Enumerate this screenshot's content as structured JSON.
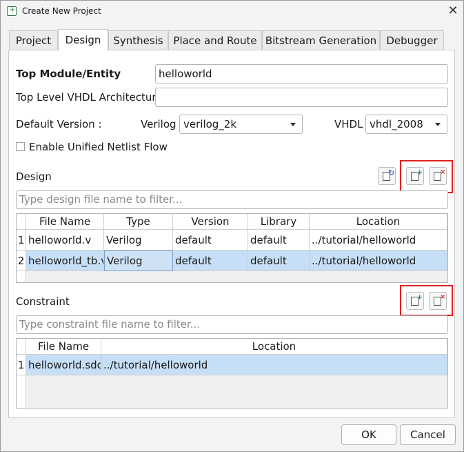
{
  "window": {
    "title": "Create New Project",
    "close_glyph": "✕"
  },
  "tabs": [
    "Project",
    "Design",
    "Synthesis",
    "Place and Route",
    "Bitstream Generation",
    "Debugger"
  ],
  "active_tab": "Design",
  "top_module": {
    "label": "Top Module/Entity",
    "value": "helloworld"
  },
  "top_vhdl_arch": {
    "label": "Top Level VHDL Architecture",
    "value": ""
  },
  "default_version": {
    "label": "Default Version :",
    "verilog_label": "Verilog",
    "verilog_value": "verilog_2k",
    "vhdl_label": "VHDL",
    "vhdl_value": "vhdl_2008"
  },
  "unified_netlist": {
    "label": "Enable Unified Netlist Flow",
    "checked": false
  },
  "design": {
    "label": "Design",
    "filter_placeholder": "Type design file name to filter...",
    "columns": [
      "File Name",
      "Type",
      "Version",
      "Library",
      "Location"
    ],
    "rows": [
      {
        "num": "1",
        "file": "helloworld.v",
        "type": "Verilog",
        "version": "default",
        "library": "default",
        "location": "../tutorial/helloworld"
      },
      {
        "num": "2",
        "file": "helloworld_tb.v",
        "type": "Verilog",
        "version": "default",
        "library": "default",
        "location": "../tutorial/helloworld"
      }
    ],
    "selected_row": 2
  },
  "constraint": {
    "label": "Constraint",
    "filter_placeholder": "Type constraint file name to filter...",
    "columns": [
      "File Name",
      "Location"
    ],
    "rows": [
      {
        "num": "1",
        "file": "helloworld.sdc",
        "location": "../tutorial/helloworld"
      }
    ],
    "selected_row": 1
  },
  "icons": {
    "refresh": "refresh-file-icon",
    "add": "add-file-icon",
    "remove": "remove-file-icon",
    "glyph_plus": "+",
    "glyph_cross": "×",
    "glyph_refresh": "↻"
  },
  "highlight_color": "#e02020",
  "selection_color": "#c6dff6",
  "buttons": {
    "ok": "OK",
    "cancel": "Cancel"
  }
}
